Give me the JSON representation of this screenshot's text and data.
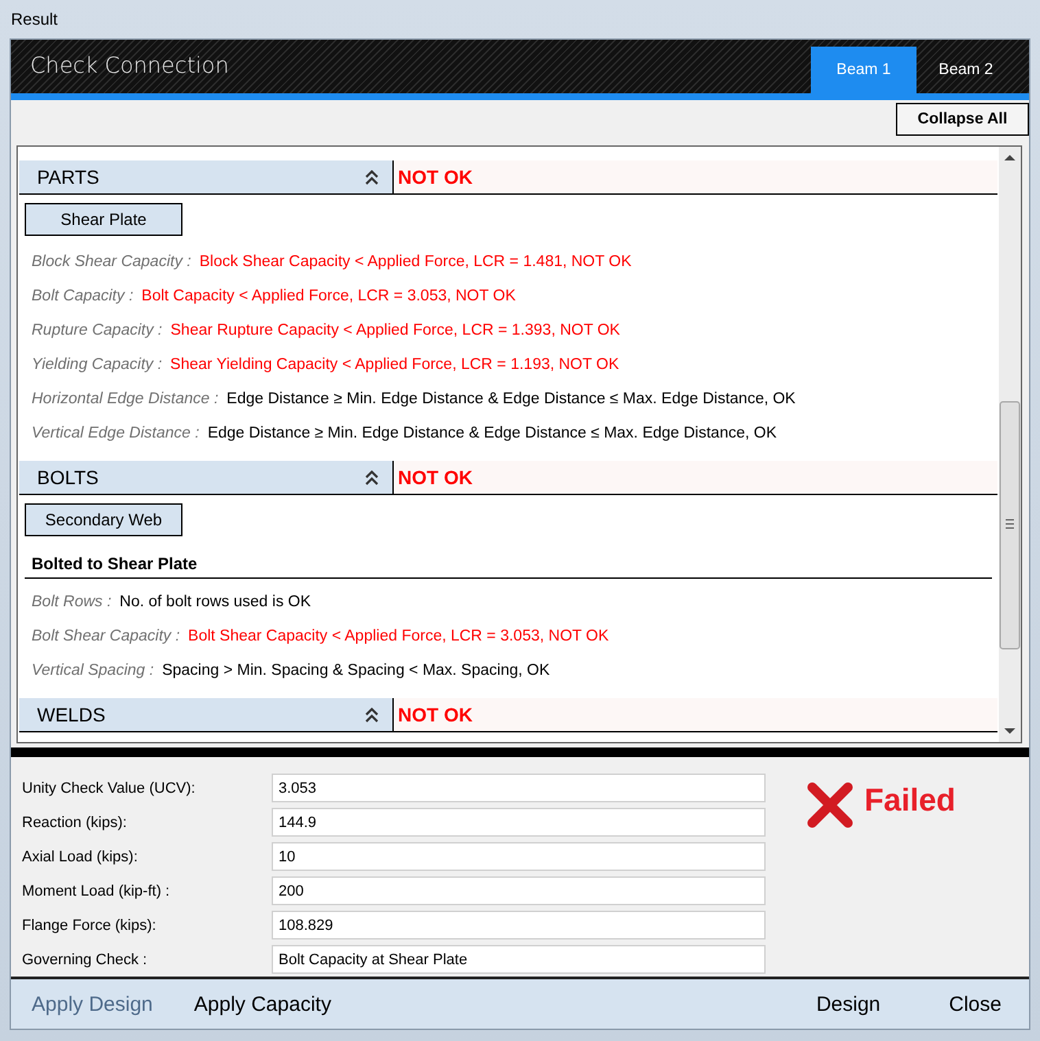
{
  "window": {
    "title": "Result"
  },
  "header": {
    "title": "Check Connection"
  },
  "tabs": [
    {
      "label": "Beam 1",
      "selected": true
    },
    {
      "label": "Beam 2",
      "selected": false
    }
  ],
  "collapse_button": "Collapse All",
  "sections": [
    {
      "title": "PARTS",
      "status": "NOT OK",
      "ok": false,
      "expanded": true,
      "groups": [
        {
          "button": "Shear Plate",
          "checks": [
            {
              "label": "Block Shear Capacity :",
              "result": "Block Shear Capacity < Applied Force, LCR = 1.481, NOT OK",
              "ok": false
            },
            {
              "label": "Bolt Capacity :",
              "result": "Bolt Capacity < Applied Force, LCR = 3.053, NOT OK",
              "ok": false
            },
            {
              "label": "Rupture Capacity :",
              "result": "Shear Rupture Capacity < Applied Force, LCR = 1.393, NOT OK",
              "ok": false
            },
            {
              "label": "Yielding Capacity :",
              "result": "Shear Yielding Capacity < Applied Force, LCR = 1.193, NOT OK",
              "ok": false
            },
            {
              "label": "Horizontal Edge Distance :",
              "result": "Edge Distance ≥ Min. Edge Distance & Edge Distance ≤ Max. Edge Distance, OK",
              "ok": true
            },
            {
              "label": "Vertical Edge Distance :",
              "result": "Edge Distance ≥ Min. Edge Distance & Edge Distance ≤ Max. Edge Distance, OK",
              "ok": true
            }
          ]
        }
      ]
    },
    {
      "title": "BOLTS",
      "status": "NOT OK",
      "ok": false,
      "expanded": true,
      "groups": [
        {
          "button": "Secondary Web",
          "subheading": "Bolted to Shear Plate",
          "checks": [
            {
              "label": "Bolt Rows :",
              "result": "No. of bolt rows used is OK",
              "ok": true
            },
            {
              "label": "Bolt Shear Capacity :",
              "result": "Bolt Shear Capacity < Applied Force, LCR = 3.053, NOT OK",
              "ok": false
            },
            {
              "label": "Vertical Spacing :",
              "result": "Spacing > Min. Spacing & Spacing < Max. Spacing, OK",
              "ok": true
            }
          ]
        }
      ]
    },
    {
      "title": "WELDS",
      "status": "NOT OK",
      "ok": false,
      "expanded": true
    }
  ],
  "summary": [
    {
      "label": "Unity Check Value (UCV):",
      "value": "3.053"
    },
    {
      "label": "Reaction (kips):",
      "value": "144.9"
    },
    {
      "label": "Axial Load (kips):",
      "value": "10"
    },
    {
      "label": "Moment Load (kip-ft) :",
      "value": "200"
    },
    {
      "label": "Flange Force (kips):",
      "value": "108.829"
    },
    {
      "label": "Governing Check :",
      "value": "Bolt Capacity at Shear Plate"
    }
  ],
  "result": {
    "text": "Failed",
    "passed": false
  },
  "footer_left": [
    {
      "label": "Apply Design",
      "disabled": true
    },
    {
      "label": "Apply Capacity",
      "disabled": false
    }
  ],
  "footer_right": [
    {
      "label": "Design",
      "disabled": false
    },
    {
      "label": "Close",
      "disabled": false
    }
  ]
}
